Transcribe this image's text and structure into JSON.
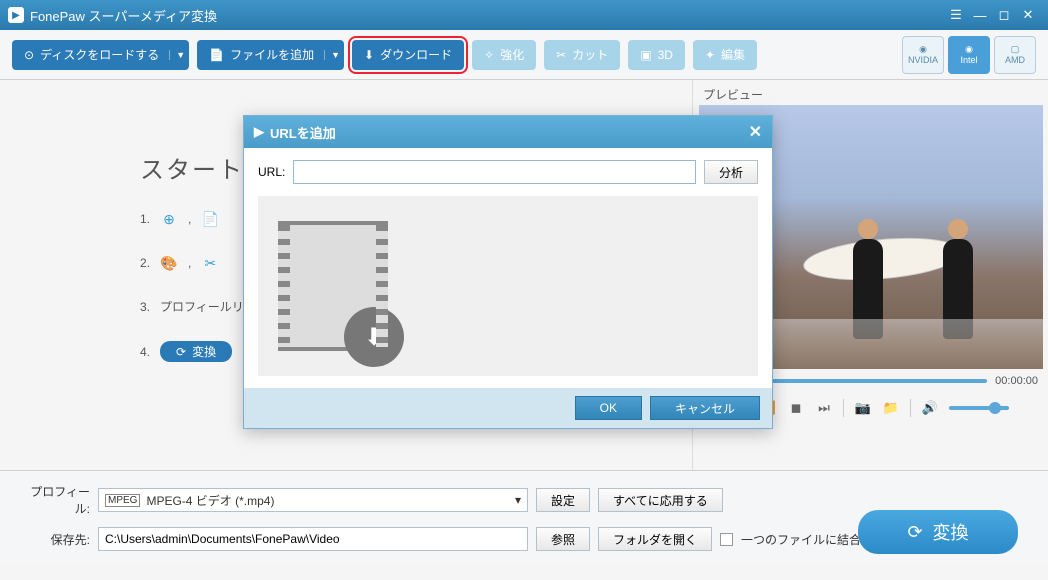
{
  "titlebar": {
    "app_name": "FonePaw スーパーメディア変換"
  },
  "toolbar": {
    "load_disc": "ディスクをロードする",
    "add_file": "ファイルを追加",
    "download": "ダウンロード",
    "enhance": "強化",
    "cut": "カット",
    "threeD": "3D",
    "edit": "編集"
  },
  "gpu": {
    "nvidia": "NVIDIA",
    "intel": "Intel",
    "amd": "AMD"
  },
  "start": {
    "title": "スタート",
    "step3": "プロフィールリスト",
    "convert": "変換"
  },
  "preview": {
    "title": "プレビュー",
    "time": "00:00:00"
  },
  "modal": {
    "title": "URLを追加",
    "url_label": "URL:",
    "analyze": "分析",
    "ok": "OK",
    "cancel": "キャンセル"
  },
  "bottom": {
    "profile_label": "プロフィール:",
    "profile_value": "MPEG-4 ビデオ (*.mp4)",
    "settings": "設定",
    "apply_all": "すべてに応用する",
    "save_label": "保存先:",
    "save_path": "C:\\Users\\admin\\Documents\\FonePaw\\Video",
    "browse": "参照",
    "open_folder": "フォルダを開く",
    "merge": "一つのファイルに結合",
    "convert": "変換"
  }
}
